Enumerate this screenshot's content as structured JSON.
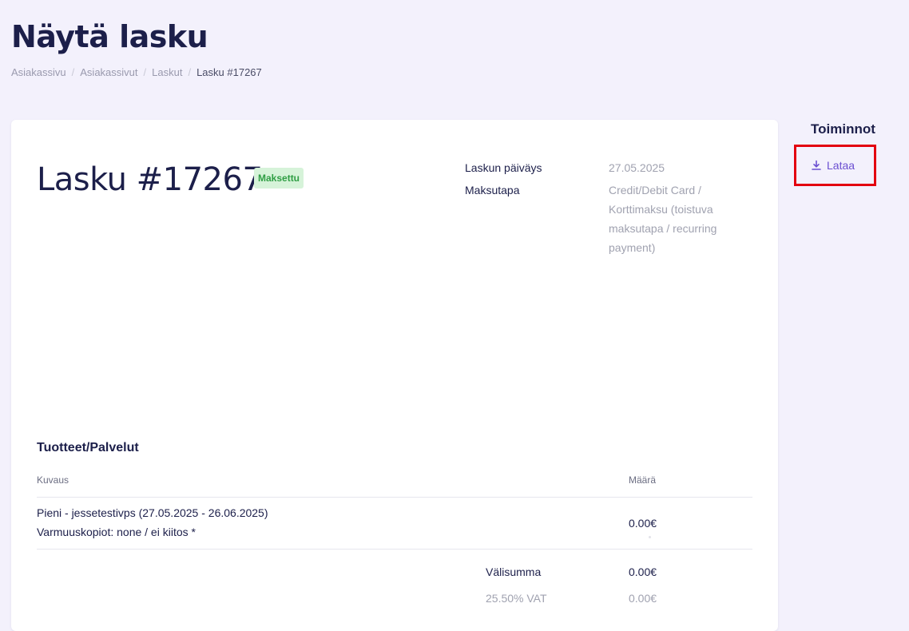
{
  "header": {
    "title": "Näytä lasku",
    "breadcrumb": [
      "Asiakassivu",
      "Asiakassivut",
      "Laskut",
      "Lasku #17267"
    ]
  },
  "invoice": {
    "title": "Lasku #17267",
    "status": "Maksettu",
    "date_label": "Laskun päiväys",
    "date_value": "27.05.2025",
    "payment_label": "Maksutapa",
    "payment_lines": [
      "Credit/Debit Card /",
      "Korttimaksu (toistuva",
      "maksutapa / recurring",
      "payment)"
    ]
  },
  "items": {
    "section_title": "Tuotteet/Palvelut",
    "col_description": "Kuvaus",
    "col_amount": "Määrä",
    "rows": [
      {
        "line1": "Pieni - jessetestivps (27.05.2025 - 26.06.2025)",
        "line2": "Varmuuskopiot: none / ei kiitos *",
        "amount": "0.00€"
      }
    ],
    "subtotal_label": "Välisumma",
    "subtotal_value": "0.00€",
    "vat_label": "25.50% VAT",
    "vat_value": "0.00€"
  },
  "sidebar": {
    "title": "Toiminnot",
    "download_label": "Lataa",
    "download_icon": "download-icon"
  },
  "colors": {
    "background": "#f3f1fc",
    "primary_text": "#1c1f4a",
    "link": "#6b4fd1",
    "paid_badge_bg": "#d6f3d9",
    "paid_badge_text": "#2f9e44",
    "highlight_border": "#e3000f"
  }
}
